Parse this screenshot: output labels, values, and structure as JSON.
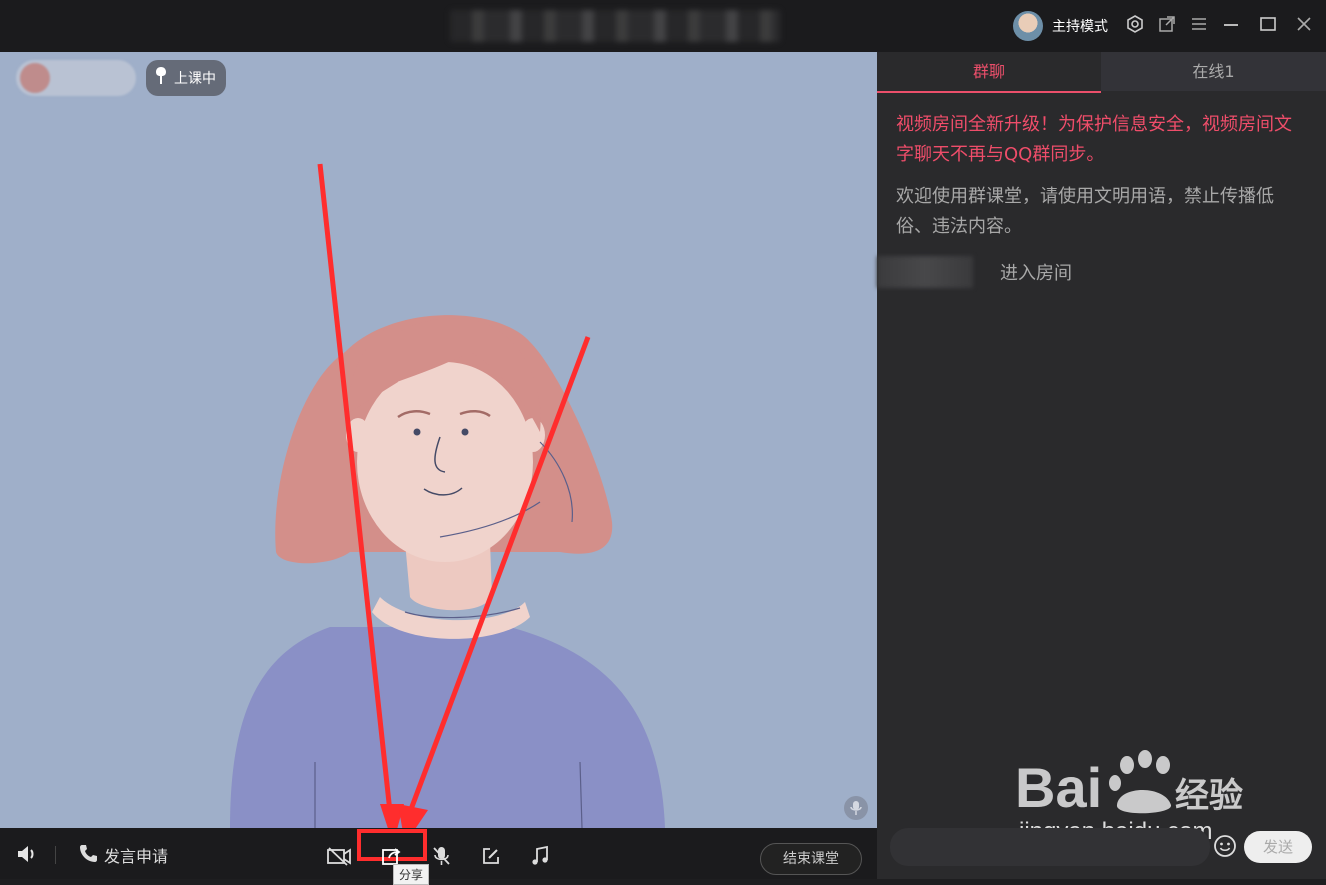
{
  "titlebar": {
    "host_mode_label": "主持模式"
  },
  "video": {
    "status_badge": "上课中"
  },
  "controls": {
    "speak_apply_label": "发言申请",
    "share_tooltip": "分享",
    "end_class_label": "结束课堂"
  },
  "chat": {
    "tabs": [
      {
        "label": "群聊",
        "active": true
      },
      {
        "label": "在线1",
        "active": false
      }
    ],
    "notice": "视频房间全新升级！为保护信息安全，视频房间文字聊天不再与QQ群同步。",
    "welcome": "欢迎使用群课堂，请使用文明用语，禁止传播低俗、违法内容。",
    "join_event": "进入房间",
    "send_label": "发送"
  },
  "watermark": {
    "brand": "Bai",
    "brand_suffix": "经验",
    "url": "jingyan.baidu.com"
  },
  "colors": {
    "accent": "#ec4f6b",
    "annotation_red": "#ff2d2d",
    "video_bg": "#9fafc9"
  },
  "icons": [
    "settings-icon",
    "popout-icon",
    "menu-icon",
    "minimize-icon",
    "maximize-icon",
    "close-icon",
    "volume-icon",
    "phone-icon",
    "camera-off-icon",
    "share-icon",
    "mic-off-icon",
    "edit-icon",
    "music-icon",
    "emoji-icon",
    "mic-indicator-icon"
  ]
}
